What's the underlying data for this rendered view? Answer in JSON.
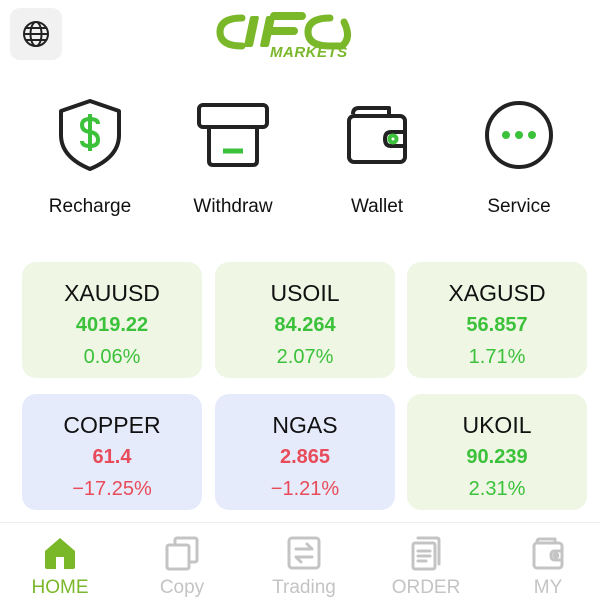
{
  "header": {
    "globe_icon": "globe-icon",
    "logo_text": "IFC",
    "logo_subtext": "MARKETS",
    "brand_color": "#7ab82a"
  },
  "actions": [
    {
      "label": "Recharge",
      "icon": "shield-dollar-icon"
    },
    {
      "label": "Withdraw",
      "icon": "atm-withdraw-icon"
    },
    {
      "label": "Wallet",
      "icon": "wallet-icon"
    },
    {
      "label": "Service",
      "icon": "chat-dots-icon"
    }
  ],
  "quotes": [
    {
      "symbol": "XAUUSD",
      "price": "4019.22",
      "change": "0.06%",
      "direction": "up"
    },
    {
      "symbol": "USOIL",
      "price": "84.264",
      "change": "2.07%",
      "direction": "up"
    },
    {
      "symbol": "XAGUSD",
      "price": "56.857",
      "change": "1.71%",
      "direction": "up"
    },
    {
      "symbol": "COPPER",
      "price": "61.4",
      "change": "−17.25%",
      "direction": "down"
    },
    {
      "symbol": "NGAS",
      "price": "2.865",
      "change": "−1.21%",
      "direction": "down"
    },
    {
      "symbol": "UKOIL",
      "price": "90.239",
      "change": "2.31%",
      "direction": "up"
    }
  ],
  "colors": {
    "up": "#3cc13b",
    "down": "#e84b5a",
    "card_up_bg": "#eff6e4",
    "card_down_bg": "#e6ebfb",
    "tab_inactive": "#c4c4c4"
  },
  "tabs": [
    {
      "label": "HOME",
      "icon": "home-icon",
      "active": true
    },
    {
      "label": "Copy",
      "icon": "copy-icon",
      "active": false
    },
    {
      "label": "Trading",
      "icon": "trading-swap-icon",
      "active": false
    },
    {
      "label": "ORDER",
      "icon": "order-document-icon",
      "active": false
    },
    {
      "label": "MY",
      "icon": "wallet-profile-icon",
      "active": false
    }
  ]
}
